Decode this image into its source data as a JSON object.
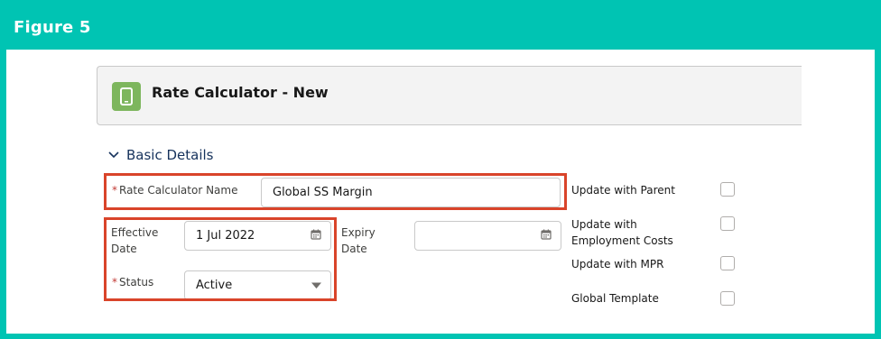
{
  "figure_label": "Figure 5",
  "header": {
    "title": "Rate Calculator - New",
    "icon": "mobile-device-icon"
  },
  "section": {
    "title": "Basic Details",
    "expanded": true
  },
  "fields": {
    "rate_calculator_name": {
      "label": "Rate Calculator Name",
      "required": "*",
      "value": "Global SS Margin"
    },
    "effective_date": {
      "label_line1": "Effective",
      "label_line2": "Date",
      "value": "1 Jul 2022"
    },
    "expiry_date": {
      "label_line1": "Expiry",
      "label_line2": "Date",
      "value": ""
    },
    "status": {
      "label": "Status",
      "required": "*",
      "value": "Active"
    }
  },
  "checkboxes": [
    {
      "label_line1": "Update with Parent",
      "label_line2": "",
      "checked": false
    },
    {
      "label_line1": "Update with",
      "label_line2": "Employment Costs",
      "checked": false
    },
    {
      "label_line1": "Update with MPR",
      "label_line2": "",
      "checked": false
    },
    {
      "label_line1": "Global Template",
      "label_line2": "",
      "checked": false
    }
  ],
  "colors": {
    "frame": "#00c4b3",
    "highlight": "#d9442a",
    "app_icon": "#7db65d",
    "section_title": "#16325c",
    "required": "#c23934"
  }
}
